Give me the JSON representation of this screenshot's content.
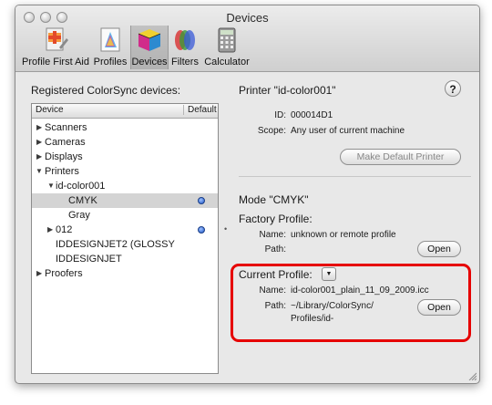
{
  "window": {
    "title": "Devices"
  },
  "toolbar": {
    "items": [
      {
        "label": "Profile First Aid",
        "icon": "profile-first-aid-icon"
      },
      {
        "label": "Profiles",
        "icon": "profiles-icon"
      },
      {
        "label": "Devices",
        "icon": "devices-icon",
        "selected": true
      },
      {
        "label": "Filters",
        "icon": "filters-icon"
      },
      {
        "label": "Calculator",
        "icon": "calculator-icon"
      }
    ]
  },
  "left": {
    "heading": "Registered ColorSync devices:",
    "columns": {
      "device": "Device",
      "default": "Default"
    },
    "rows": [
      {
        "label": "Scanners"
      },
      {
        "label": "Cameras"
      },
      {
        "label": "Displays"
      },
      {
        "label": "Printers"
      },
      {
        "label": "id-color001"
      },
      {
        "label": "CMYK",
        "selected": true
      },
      {
        "label": "Gray"
      },
      {
        "label": "012"
      },
      {
        "label": "IDDESIGNJET2 (GLOSSY"
      },
      {
        "label": "IDDESIGNJET"
      },
      {
        "label": "Proofers"
      }
    ]
  },
  "right": {
    "printer_title": "Printer \"id-color001\"",
    "help": "?",
    "id_label": "ID:",
    "id_value": "000014D1",
    "scope_label": "Scope:",
    "scope_value": "Any user of current machine",
    "make_default_button": "Make Default Printer",
    "mode_title": "Mode \"CMYK\"",
    "factory_profile_title": "Factory Profile:",
    "factory_name_label": "Name:",
    "factory_name_value": "unknown or remote profile",
    "factory_path_label": "Path:",
    "factory_open_button": "Open",
    "current_profile_title": "Current Profile:",
    "current_name_label": "Name:",
    "current_name_value": "id-color001_plain_11_09_2009.icc",
    "current_path_label": "Path:",
    "current_path_line1": "~/Library/ColorSync/",
    "current_path_line2": "Profiles/id-",
    "current_open_button": "Open"
  },
  "colors": {
    "highlight": "#e60000",
    "default_dot": "#1e56c8"
  }
}
